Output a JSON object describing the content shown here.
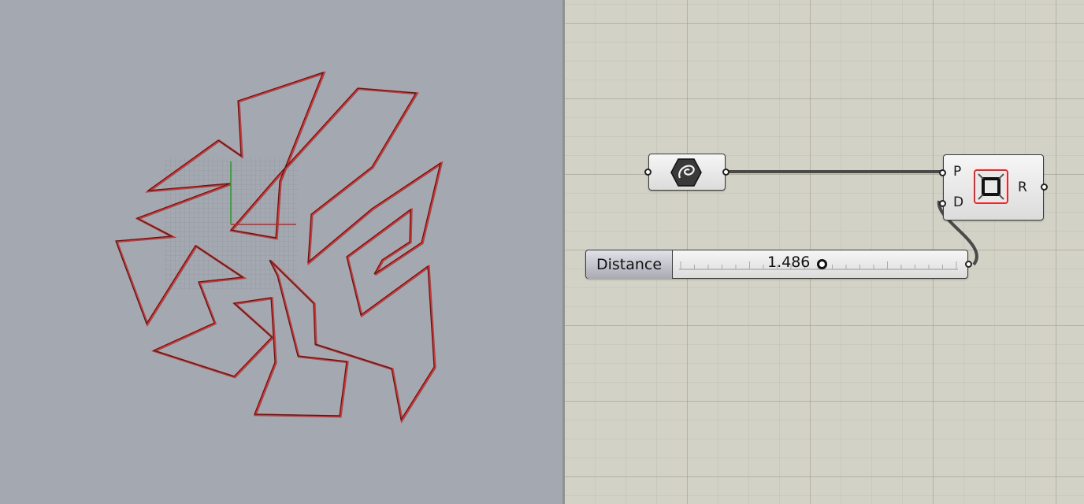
{
  "viewport": {
    "background": "#a4a9b1",
    "curve_color": "#e03030",
    "outline_color": "#2a2a2a",
    "x_axis_color": "#d02020",
    "y_axis_color": "#20a020"
  },
  "canvas": {
    "background": "#d3d2c7"
  },
  "curve_param": {
    "icon": "curve-hexagon-icon"
  },
  "offset_component": {
    "input_p": "P",
    "input_d": "D",
    "output_r": "R",
    "icon": "offset-curve-icon"
  },
  "slider": {
    "name": "Distance",
    "value": "1.486",
    "fraction": 0.47
  }
}
